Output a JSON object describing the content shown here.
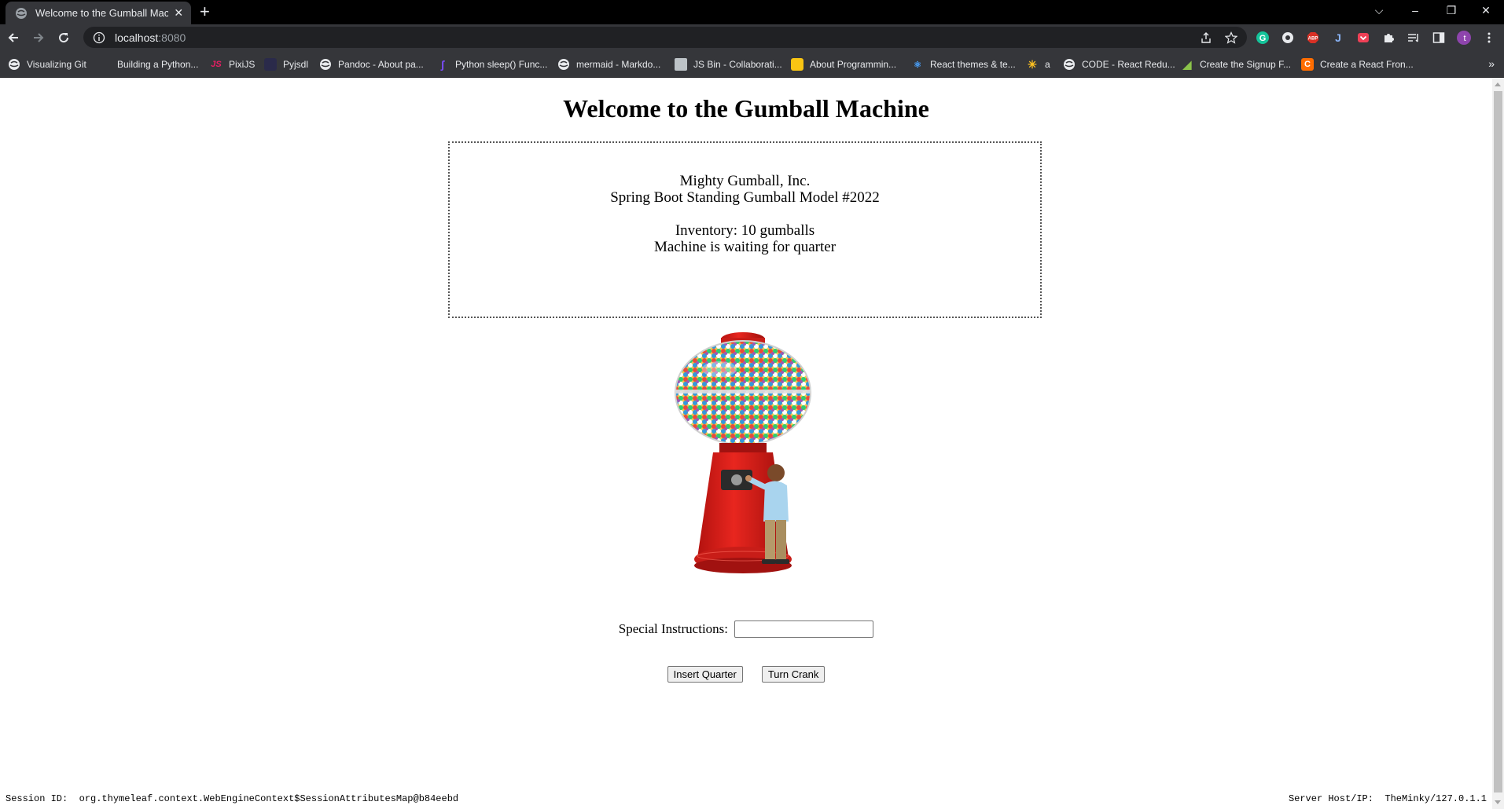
{
  "browser": {
    "tab_title": "Welcome to the Gumball Machine",
    "tab_close": "✕",
    "new_tab": "+",
    "window_controls": {
      "collapse": "⌵",
      "minimize": "–",
      "restore": "❐",
      "close": "✕"
    },
    "url_host": "localhost",
    "url_port": ":8080",
    "profile_initial": "t",
    "bookmarks": [
      {
        "label": "Visualizing Git",
        "icon": "globe-icon"
      },
      {
        "label": "Building a Python...",
        "icon": "blank-icon"
      },
      {
        "label": "PixiJS",
        "icon": "js-icon"
      },
      {
        "label": "Pyjsdl",
        "icon": "pyjsdl-icon"
      },
      {
        "label": "Pandoc - About pa...",
        "icon": "globe-icon"
      },
      {
        "label": "Python sleep() Func...",
        "icon": "python-icon"
      },
      {
        "label": "mermaid - Markdo...",
        "icon": "globe-icon"
      },
      {
        "label": "JS Bin - Collaborati...",
        "icon": "jsbin-icon"
      },
      {
        "label": "About Programmin...",
        "icon": "folder-icon"
      },
      {
        "label": "React themes & te...",
        "icon": "react-icon"
      },
      {
        "label": "a",
        "icon": "walmart-icon"
      },
      {
        "label": "CODE - React Redu...",
        "icon": "globe-icon"
      },
      {
        "label": "Create the Signup F...",
        "icon": "signup-icon"
      },
      {
        "label": "Create a React Fron...",
        "icon": "c-icon"
      }
    ],
    "bookmarks_more": "»"
  },
  "page": {
    "title": "Welcome to the Gumball Machine",
    "company": "Mighty Gumball, Inc.",
    "model": "Spring Boot Standing Gumball Model #2022",
    "inventory": "Inventory: 10 gumballs",
    "state": "Machine is waiting for quarter",
    "instructions_label": "Special Instructions:",
    "instructions_value": "",
    "insert_quarter_label": "Insert Quarter",
    "turn_crank_label": "Turn Crank",
    "session_label": "Session ID:",
    "session_value": "org.thymeleaf.context.WebEngineContext$SessionAttributesMap@b84eebd",
    "server_label": "Server Host/IP:",
    "server_value": "TheMinky/127.0.1.1"
  },
  "colors": {
    "tabbar": "#000000",
    "toolbar": "#35363a",
    "machine_red": "#d4201c"
  }
}
